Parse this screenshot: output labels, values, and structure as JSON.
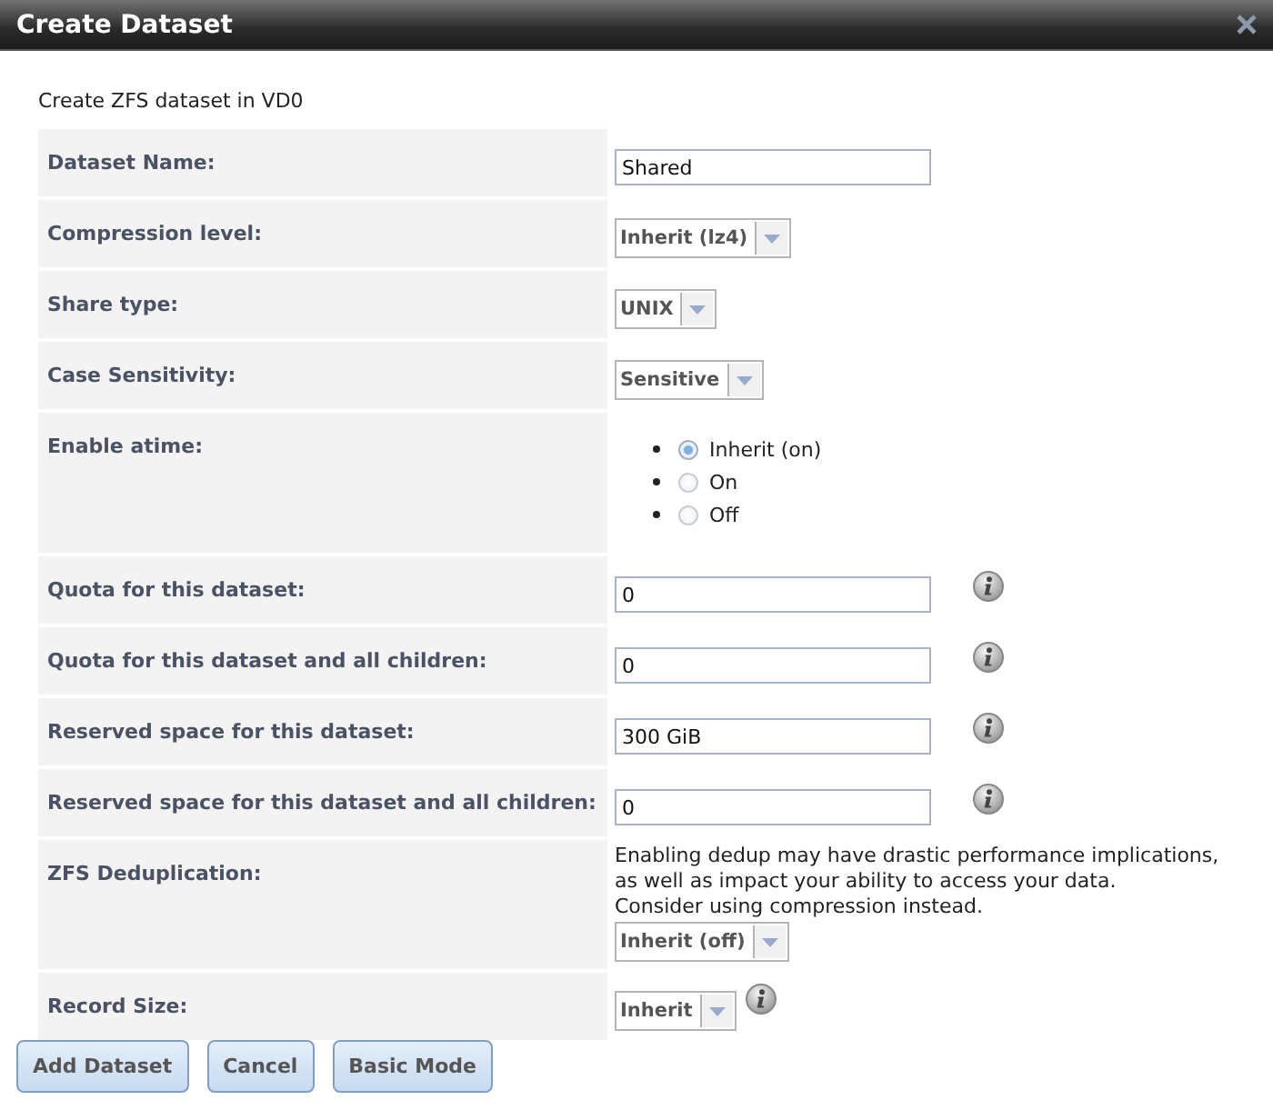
{
  "window": {
    "title": "Create Dataset"
  },
  "intro": "Create ZFS dataset in VD0",
  "rows": [
    {
      "kind": "text",
      "label": "Dataset Name:",
      "value": "Shared",
      "help": false
    },
    {
      "kind": "select",
      "label": "Compression level:",
      "value": "Inherit (lz4)",
      "help": false
    },
    {
      "kind": "select",
      "label": "Share type:",
      "value": "UNIX",
      "help": false
    },
    {
      "kind": "select",
      "label": "Case Sensitivity:",
      "value": "Sensitive",
      "help": false
    },
    {
      "kind": "radio",
      "label": "Enable atime:",
      "options": [
        {
          "label": "Inherit (on)",
          "selected": true
        },
        {
          "label": "On",
          "selected": false
        },
        {
          "label": "Off",
          "selected": false
        }
      ]
    },
    {
      "kind": "text",
      "label": "Quota for this dataset:",
      "value": "0",
      "help": true
    },
    {
      "kind": "text",
      "label": "Quota for this dataset and all children:",
      "value": "0",
      "help": true
    },
    {
      "kind": "text",
      "label": "Reserved space for this dataset:",
      "value": "300 GiB",
      "help": true
    },
    {
      "kind": "text",
      "label": "Reserved space for this dataset and all children:",
      "value": "0",
      "help": true
    },
    {
      "kind": "select",
      "label": "ZFS Deduplication:",
      "note": "Enabling dedup may have drastic performance implications,\nas well as impact your ability to access your data.\nConsider using compression instead.",
      "value": "Inherit (off)",
      "help": false
    },
    {
      "kind": "select",
      "label": "Record Size:",
      "value": "Inherit",
      "help": true
    }
  ],
  "buttons": [
    "Add Dataset",
    "Cancel",
    "Basic Mode"
  ]
}
